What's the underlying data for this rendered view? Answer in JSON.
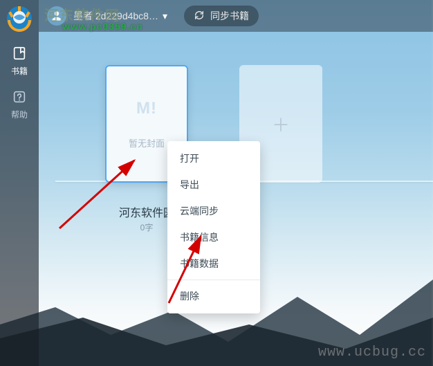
{
  "topbar": {
    "username": "墨者 2d229d4bc8…",
    "sync_label": "同步书籍"
  },
  "sidebar": {
    "items": [
      {
        "name": "books",
        "label": "书籍"
      },
      {
        "name": "help",
        "label": "帮助"
      }
    ]
  },
  "shelf": {
    "book": {
      "placeholder": "暂无封面",
      "title": "河东软件园",
      "word_count": "0字",
      "logo_text": "M!"
    }
  },
  "context_menu": {
    "open": "打开",
    "export": "导出",
    "cloud_sync": "云端同步",
    "book_info": "书籍信息",
    "book_data": "书籍数据",
    "delete": "删除"
  },
  "watermarks": {
    "site_cn": "河东软件网",
    "site_url1": "www.pc0359.cn",
    "site_url2": "www.ucbug.cc"
  }
}
